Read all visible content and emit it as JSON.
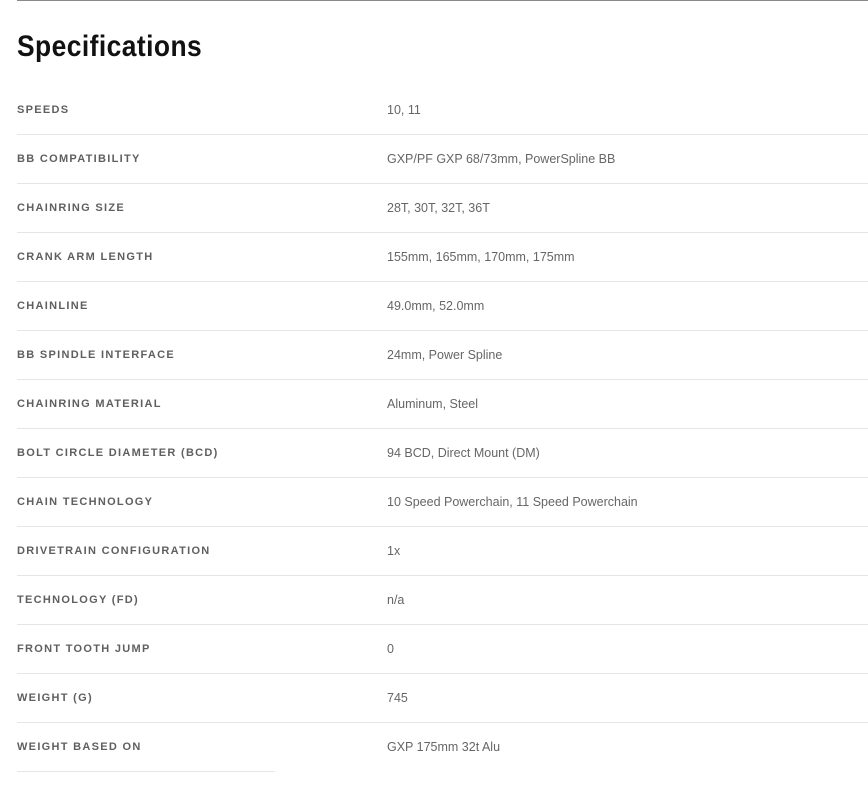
{
  "section": {
    "title": "Specifications"
  },
  "specs": [
    {
      "label": "SPEEDS",
      "value": "10, 11"
    },
    {
      "label": "BB COMPATIBILITY",
      "value": "GXP/PF GXP 68/73mm, PowerSpline BB"
    },
    {
      "label": "CHAINRING SIZE",
      "value": "28T, 30T, 32T, 36T"
    },
    {
      "label": "CRANK ARM LENGTH",
      "value": "155mm, 165mm, 170mm, 175mm"
    },
    {
      "label": "CHAINLINE",
      "value": "49.0mm, 52.0mm"
    },
    {
      "label": "BB SPINDLE INTERFACE",
      "value": "24mm, Power Spline"
    },
    {
      "label": "CHAINRING MATERIAL",
      "value": "Aluminum, Steel"
    },
    {
      "label": "BOLT CIRCLE DIAMETER (BCD)",
      "value": "94 BCD, Direct Mount (DM)"
    },
    {
      "label": "CHAIN TECHNOLOGY",
      "value": "10 Speed Powerchain, 11 Speed Powerchain"
    },
    {
      "label": "DRIVETRAIN CONFIGURATION",
      "value": "1x"
    },
    {
      "label": "TECHNOLOGY (FD)",
      "value": "n/a"
    },
    {
      "label": "FRONT TOOTH JUMP",
      "value": "0"
    },
    {
      "label": "WEIGHT (G)",
      "value": "745"
    },
    {
      "label": "WEIGHT BASED ON",
      "value": "GXP 175mm 32t Alu"
    }
  ]
}
